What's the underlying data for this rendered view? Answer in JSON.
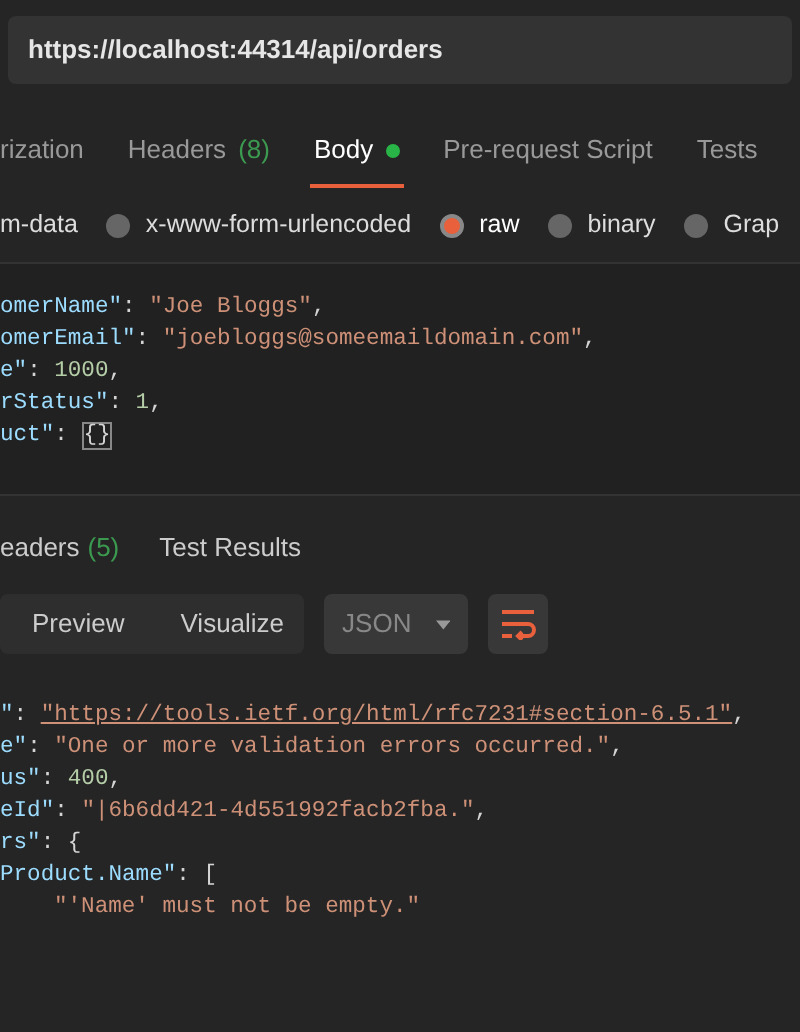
{
  "url": "https://localhost:44314/api/orders",
  "request_tabs": [
    {
      "label": "rization",
      "dot": false,
      "selected": false
    },
    {
      "label": "Headers",
      "count": "(8)",
      "dot": false,
      "selected": false
    },
    {
      "label": "Body",
      "dot": true,
      "selected": true
    },
    {
      "label": "Pre-request Script",
      "dot": false,
      "selected": false
    },
    {
      "label": "Tests",
      "dot": false,
      "selected": false
    }
  ],
  "body_types": [
    {
      "label": "m-data",
      "radio": false,
      "selected": false
    },
    {
      "label": "x-www-form-urlencoded",
      "radio": true,
      "selected": false
    },
    {
      "label": "raw",
      "radio": true,
      "selected": true
    },
    {
      "label": "binary",
      "radio": true,
      "selected": false
    },
    {
      "label": "Grap",
      "radio": true,
      "selected": false
    }
  ],
  "request_body": [
    [
      {
        "kind": "key",
        "text": "omerName\""
      },
      {
        "kind": "punct",
        "text": ": "
      },
      {
        "kind": "string",
        "text": "\"Joe Bloggs\""
      },
      {
        "kind": "punct",
        "text": ","
      }
    ],
    [
      {
        "kind": "key",
        "text": "omerEmail\""
      },
      {
        "kind": "punct",
        "text": ": "
      },
      {
        "kind": "string",
        "text": "\"joebloggs@someemaildomain.com\""
      },
      {
        "kind": "punct",
        "text": ","
      }
    ],
    [
      {
        "kind": "key",
        "text": "e\""
      },
      {
        "kind": "punct",
        "text": ": "
      },
      {
        "kind": "number",
        "text": "1000"
      },
      {
        "kind": "punct",
        "text": ","
      }
    ],
    [
      {
        "kind": "key",
        "text": "rStatus\""
      },
      {
        "kind": "punct",
        "text": ": "
      },
      {
        "kind": "number",
        "text": "1"
      },
      {
        "kind": "punct",
        "text": ","
      }
    ],
    [
      {
        "kind": "key",
        "text": "uct\""
      },
      {
        "kind": "punct",
        "text": ": "
      },
      {
        "kind": "match",
        "text": "{}"
      }
    ]
  ],
  "response_tabs": [
    {
      "label": "eaders",
      "count": "(5)"
    },
    {
      "label": "Test Results"
    }
  ],
  "view_modes": [
    {
      "label": "Preview",
      "selected": false
    },
    {
      "label": "Visualize",
      "selected": false
    }
  ],
  "format": "JSON",
  "response_body": [
    [
      {
        "kind": "key",
        "text": "\""
      },
      {
        "kind": "punct",
        "text": ": "
      },
      {
        "kind": "link",
        "text": "\"https://tools.ietf.org/html/rfc7231#section-6.5.1\""
      },
      {
        "kind": "punct",
        "text": ","
      }
    ],
    [
      {
        "kind": "key",
        "text": "e\""
      },
      {
        "kind": "punct",
        "text": ": "
      },
      {
        "kind": "string",
        "text": "\"One or more validation errors occurred.\""
      },
      {
        "kind": "punct",
        "text": ","
      }
    ],
    [
      {
        "kind": "key",
        "text": "us\""
      },
      {
        "kind": "punct",
        "text": ": "
      },
      {
        "kind": "number",
        "text": "400"
      },
      {
        "kind": "punct",
        "text": ","
      }
    ],
    [
      {
        "kind": "key",
        "text": "eId\""
      },
      {
        "kind": "punct",
        "text": ": "
      },
      {
        "kind": "string",
        "text": "\"|6b6dd421-4d551992facb2fba.\""
      },
      {
        "kind": "punct",
        "text": ","
      }
    ],
    [
      {
        "kind": "key",
        "text": "rs\""
      },
      {
        "kind": "punct",
        "text": ": {"
      }
    ],
    [
      {
        "kind": "key",
        "text": "Product.Name\""
      },
      {
        "kind": "punct",
        "text": ": ["
      }
    ],
    [
      {
        "kind": "indented_string",
        "text": "\"'Name' must not be empty.\""
      }
    ]
  ]
}
